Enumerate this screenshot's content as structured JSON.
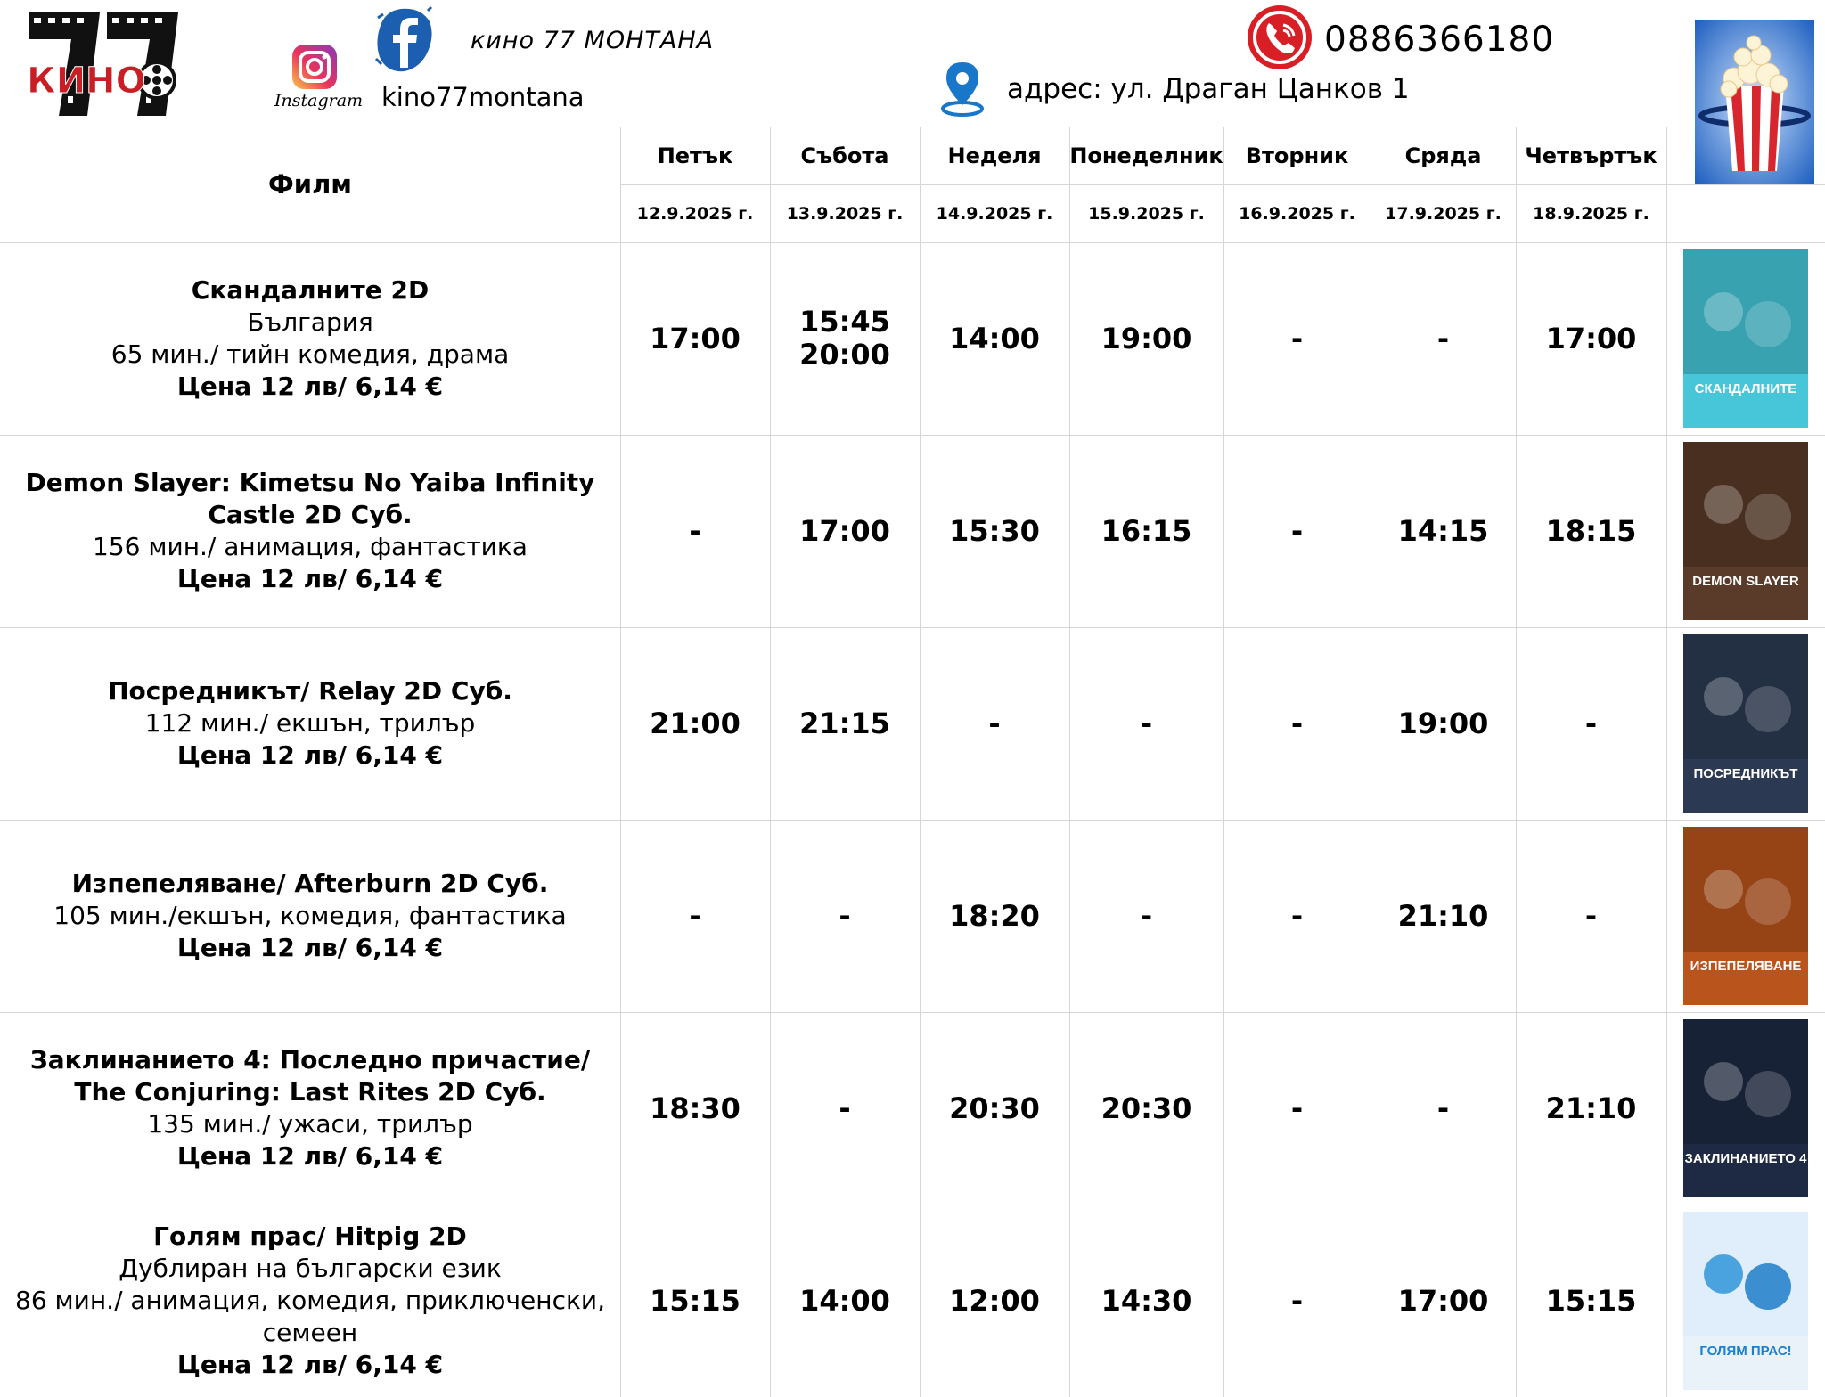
{
  "header": {
    "logo_text": "КИНО",
    "logo_number": "77",
    "instagram_label": "Instagram",
    "cinema_name": "кино 77 МОНТАНА",
    "facebook_handle": "kino77montana",
    "phone": "0886366180",
    "address": "адрес: ул. Драган Цанков 1"
  },
  "table": {
    "film_header": "Филм",
    "days": [
      {
        "name": "Петък",
        "date": "12.9.2025 г."
      },
      {
        "name": "Събота",
        "date": "13.9.2025 г."
      },
      {
        "name": "Неделя",
        "date": "14.9.2025 г."
      },
      {
        "name": "Понеделник",
        "date": "15.9.2025 г."
      },
      {
        "name": "Вторник",
        "date": "16.9.2025 г."
      },
      {
        "name": "Сряда",
        "date": "17.9.2025 г."
      },
      {
        "name": "Четвъртък",
        "date": "18.9.2025 г."
      }
    ],
    "films": [
      {
        "title_lines": [
          "Скандалните 2D"
        ],
        "detail_lines": [
          "България",
          "65 мин./ тийн комедия, драма"
        ],
        "price": "Цена 12 лв/ 6,14 €",
        "times": [
          "17:00",
          "15:45\n20:00",
          "14:00",
          "19:00",
          "-",
          "-",
          "17:00"
        ],
        "poster_text": "СКАНДАЛНИТЕ",
        "poster_color": "#46c6d8"
      },
      {
        "title_lines": [
          "Demon Slayer: Kimetsu No Yaiba Infinity",
          "Castle 2D Суб."
        ],
        "detail_lines": [
          "156 мин./ анимация, фантастика"
        ],
        "price": "Цена 12 лв/ 6,14 €",
        "times": [
          "-",
          "17:00",
          "15:30",
          "16:15",
          "-",
          "14:15",
          "18:15"
        ],
        "poster_text": "DEMON SLAYER",
        "poster_color": "#5a3a28"
      },
      {
        "title_lines": [
          "Посредникът/ Relay 2D Суб."
        ],
        "detail_lines": [
          "112 мин./ екшън, трилър"
        ],
        "price": "Цена 12 лв/ 6,14 €",
        "times": [
          "21:00",
          "21:15",
          "-",
          "-",
          "-",
          "19:00",
          "-"
        ],
        "poster_text": "ПОСРЕДНИКЪТ",
        "poster_color": "#2b3a52"
      },
      {
        "title_lines": [
          "Изпепеляване/ Afterburn 2D Суб."
        ],
        "detail_lines": [
          "105 мин./екшън, комедия, фантастика"
        ],
        "price": "Цена 12 лв/ 6,14 €",
        "times": [
          "-",
          "-",
          "18:20",
          "-",
          "-",
          "21:10",
          "-"
        ],
        "poster_text": "ИЗПЕПЕЛЯВАНЕ",
        "poster_color": "#b8541c"
      },
      {
        "title_lines": [
          "Заклинанието 4: Последно причастие/",
          "The Conjuring: Last Rites 2D Суб."
        ],
        "detail_lines": [
          "135 мин./ ужаси, трилър"
        ],
        "price": "Цена 12 лв/ 6,14 €",
        "times": [
          "18:30",
          "-",
          "20:30",
          "20:30",
          "-",
          "-",
          "21:10"
        ],
        "poster_text": "ЗАКЛИНАНИЕТО 4",
        "poster_color": "#1e2a44"
      },
      {
        "title_lines": [
          "Голям прас/ Hitpig 2D"
        ],
        "detail_lines": [
          "Дублиран на български език",
          "86 мин./ анимация, комедия, приключенски,",
          "семеен"
        ],
        "price": "Цена 12 лв/ 6,14 €",
        "times": [
          "15:15",
          "14:00",
          "12:00",
          "14:30",
          "-",
          "17:00",
          "15:15"
        ],
        "poster_text": "ГОЛЯМ ПРАС!",
        "poster_color": "#e9f2f8"
      }
    ]
  },
  "colors": {
    "grid": "#d6d6d6",
    "phone_red": "#d91f26",
    "pin_blue": "#1877c9",
    "facebook_blue": "#1c5fb0",
    "logo_red": "#c81e24"
  }
}
